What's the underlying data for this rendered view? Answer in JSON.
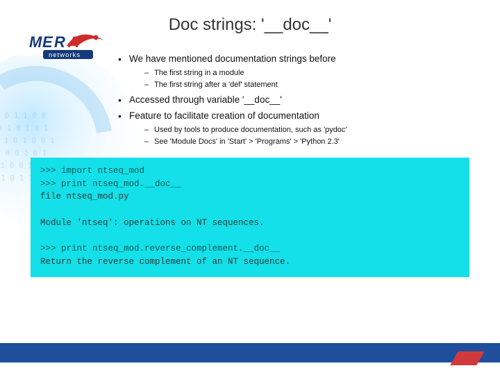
{
  "title": "Doc strings: '__doc__'",
  "logo": {
    "name": "MERA",
    "sub": "networks"
  },
  "bullets": {
    "b1": "We have mentioned documentation strings before",
    "b1a": "The first string in a module",
    "b1b": "The first string after a 'def' statement",
    "b2": "Accessed through variable '__doc__'",
    "b3": "Feature to facilitate creation of documentation",
    "b3a": "Used by tools to produce documentation, such as 'pydoc'",
    "b3b": "See 'Module Docs' in 'Start' > 'Programs' > 'Python 2.3'"
  },
  "code": {
    "l1": ">>> import ntseq_mod",
    "l2": ">>> print ntseq_mod.__doc__",
    "l3": "file ntseq_mod.py",
    "l4": "",
    "l5": "Module 'ntseq': operations on NT sequences.",
    "l6": "",
    "l7": ">>> print ntseq_mod.reverse_complement.__doc__",
    "l8": "Return the reverse complement of an NT sequence."
  },
  "colors": {
    "code_bg": "#13e0e8",
    "footer_blue": "#1f4e9c",
    "footer_red": "#d13a3c"
  }
}
